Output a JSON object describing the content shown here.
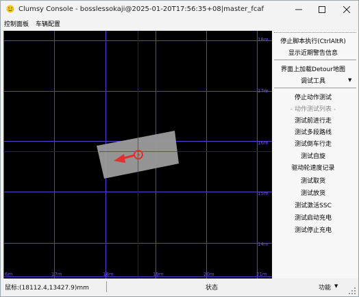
{
  "window": {
    "title": "Clumsy Console - bosslessokaji@2025-01-20T17:56:35+08|master_fcaf"
  },
  "menu": [
    "控制面板",
    "车辆配置"
  ],
  "map": {
    "x_labels": [
      "6m",
      "17m",
      "18m",
      "19m",
      "20m",
      "21m"
    ],
    "y_labels": [
      "18m",
      "17m",
      "16m",
      "15m",
      "14m"
    ],
    "grid_color": "#5b3fd0",
    "vehicle_color": "#9c9c9c",
    "arrow_color": "#e03030"
  },
  "side_panel": {
    "items": [
      {
        "label": "停止脚本执行(CtrlAltR)"
      },
      {
        "label": "显示近期警告信息"
      },
      {
        "label": "界面上加载Detour地图"
      },
      {
        "label": "调试工具"
      },
      {
        "label": "停止动作测试"
      },
      {
        "label": "- 动作测试列表 -"
      },
      {
        "label": "测试前进行走"
      },
      {
        "label": "测试多段路线"
      },
      {
        "label": "测试倒车行走"
      },
      {
        "label": "测试自旋"
      },
      {
        "label": "驱动轮速度记录"
      },
      {
        "label": "测试取货"
      },
      {
        "label": "测试放货"
      },
      {
        "label": "测试激活SSC"
      },
      {
        "label": "测试启动充电"
      },
      {
        "label": "测试停止充电"
      }
    ]
  },
  "status": {
    "mouse": "鼠标:(18112.4,13427.9)mm",
    "state": "状态",
    "function": "功能"
  }
}
